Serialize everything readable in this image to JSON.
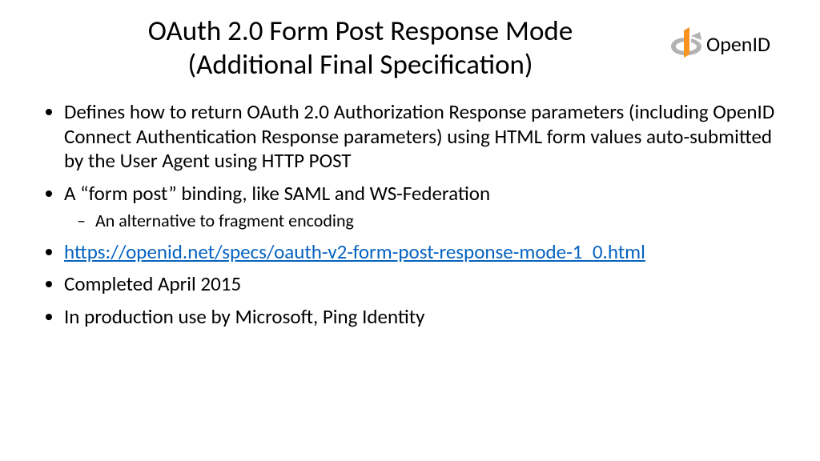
{
  "title": {
    "line1": "OAuth 2.0 Form Post Response Mode",
    "line2": "(Additional Final Specification)"
  },
  "logo": {
    "text": "OpenID",
    "accent_color": "#f7931e",
    "arrow_color": "#b3b3b3"
  },
  "bullets": [
    {
      "text": "Defines how to return OAuth 2.0 Authorization Response parameters (including OpenID Connect Authentication Response parameters) using HTML form values auto-submitted by the User Agent using HTTP POST"
    },
    {
      "text": "A “form post” binding, like SAML and WS-Federation",
      "sub": [
        "An alternative to fragment encoding"
      ]
    },
    {
      "link": "https://openid.net/specs/oauth-v2-form-post-response-mode-1_0.html"
    },
    {
      "text": "Completed April 2015"
    },
    {
      "text": "In production use by Microsoft, Ping Identity"
    }
  ]
}
